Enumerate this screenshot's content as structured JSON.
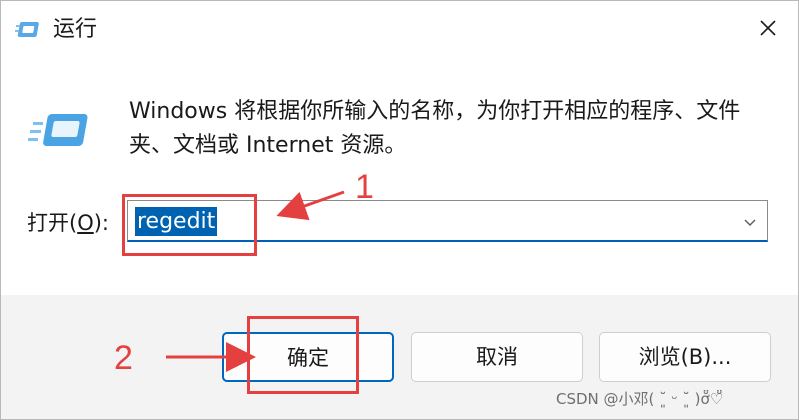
{
  "window": {
    "title": "运行",
    "title_icon": "run-icon",
    "close_icon": "close-icon"
  },
  "content": {
    "icon": "run-dialog-icon",
    "description": "Windows 将根据你所输入的名称，为你打开相应的程序、文件夹、文档或 Internet 资源。",
    "open_label_prefix": "打开(",
    "open_label_key": "O",
    "open_label_suffix": "):",
    "open_value": "regedit",
    "dropdown_icon": "chevron-down-icon"
  },
  "buttons": {
    "ok": "确定",
    "cancel": "取消",
    "browse": "浏览(B)..."
  },
  "annotations": {
    "step1": "1",
    "step2": "2",
    "color": "#e54040"
  },
  "watermark": "CSDN @小邓( ˘͈ ᵕ ˘͈ )ơ̆̈♡̆̈",
  "colors": {
    "accent": "#0067c0",
    "selection": "#0063b1"
  }
}
